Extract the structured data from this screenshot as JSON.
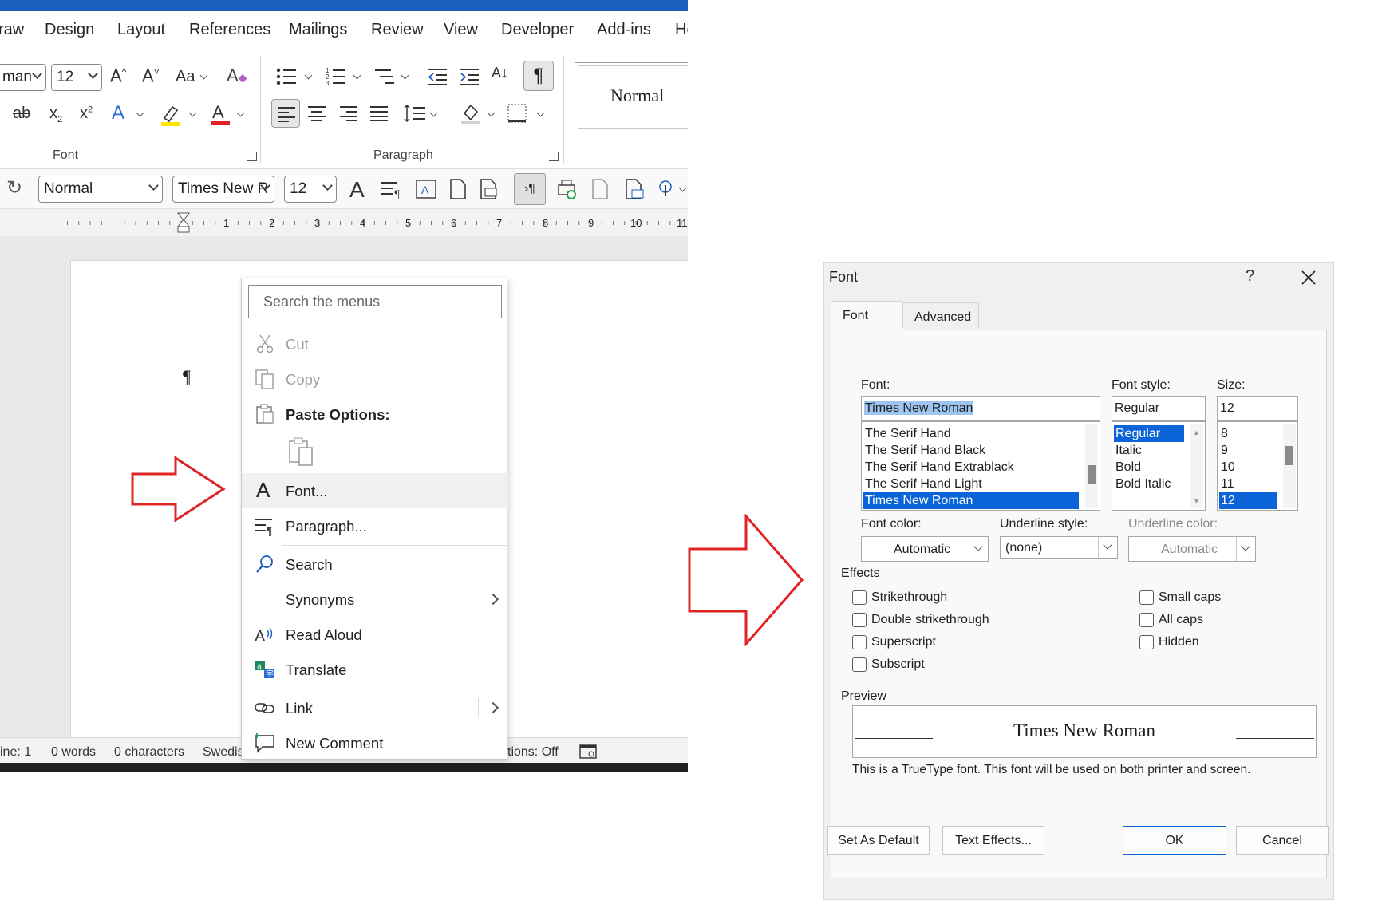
{
  "word": {
    "menu_tabs": [
      "raw",
      "Design",
      "Layout",
      "References",
      "Mailings",
      "Review",
      "View",
      "Developer",
      "Add-ins",
      "He"
    ],
    "ribbon": {
      "font_name_partial": "man",
      "font_size": "12",
      "style_gallery_item": "Normal",
      "font_group_label": "Font",
      "paragraph_group_label": "Paragraph"
    },
    "quick_access": {
      "style": "Normal",
      "font": "Times New R",
      "size": "12"
    },
    "ruler_numbers": [
      "1",
      "2",
      "3",
      "4",
      "5",
      "6",
      "7",
      "8",
      "9",
      "10",
      "11"
    ],
    "status": {
      "line": "ine: 1",
      "words": "0 words",
      "characters": "0 characters",
      "language": "Swedis",
      "predictions": "tions: Off"
    },
    "context_menu": {
      "search_placeholder": "Search the menus",
      "cut": "Cut",
      "copy": "Copy",
      "paste_options": "Paste Options:",
      "font": "Font...",
      "paragraph": "Paragraph...",
      "search": "Search",
      "synonyms": "Synonyms",
      "read_aloud": "Read Aloud",
      "translate": "Translate",
      "link": "Link",
      "new_comment": "New Comment"
    }
  },
  "dialog": {
    "title": "Font",
    "help": "?",
    "tabs": [
      "Font",
      "Advanced"
    ],
    "font_label": "Font:",
    "font_value": "Times New Roman",
    "font_list": [
      "The Serif Hand",
      "The Serif Hand Black",
      "The Serif Hand Extrablack",
      "The Serif Hand Light",
      "Times New Roman"
    ],
    "style_label": "Font style:",
    "style_value": "Regular",
    "style_list": [
      "Regular",
      "Italic",
      "Bold",
      "Bold Italic"
    ],
    "size_label": "Size:",
    "size_value": "12",
    "size_list": [
      "8",
      "9",
      "10",
      "11",
      "12"
    ],
    "font_color_label": "Font color:",
    "font_color_value": "Automatic",
    "underline_style_label": "Underline style:",
    "underline_style_value": "(none)",
    "underline_color_label": "Underline color:",
    "underline_color_value": "Automatic",
    "effects_label": "Effects",
    "effects_left": [
      "Strikethrough",
      "Double strikethrough",
      "Superscript",
      "Subscript"
    ],
    "effects_right": [
      "Small caps",
      "All caps",
      "Hidden"
    ],
    "preview_label": "Preview",
    "preview_text": "Times New Roman",
    "info_text": "This is a TrueType font. This font will be used on both printer and screen.",
    "buttons": {
      "set_default": "Set As Default",
      "text_effects": "Text Effects...",
      "ok": "OK",
      "cancel": "Cancel"
    }
  },
  "colors": {
    "accent": "#0a64d8",
    "title_bar": "#1b5ebe",
    "arrow": "#e02424"
  }
}
